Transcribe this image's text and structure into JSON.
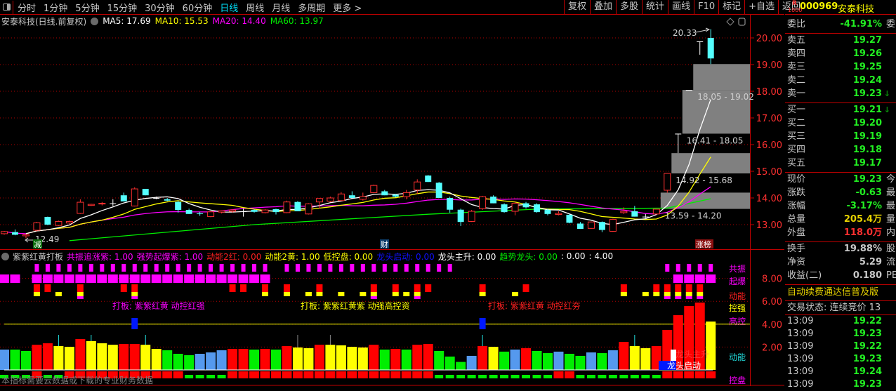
{
  "toolbar": {
    "periods": [
      "分时",
      "1分钟",
      "5分钟",
      "15分钟",
      "30分钟",
      "60分钟",
      "日线",
      "周线",
      "月线",
      "多周期",
      "更多 >"
    ],
    "active_period": "日线",
    "actions": [
      "复权",
      "叠加",
      "多股",
      "统计",
      "画线",
      "F10",
      "标记",
      "+自选",
      "返回"
    ]
  },
  "legend": {
    "title": "安泰科技(日线.前复权)",
    "ma5": "MA5: 17.69",
    "ma10": "MA10: 15.53",
    "ma20": "MA20: 14.40",
    "ma60": "MA60: 13.97"
  },
  "colors": {
    "up": "#ff3030",
    "down": "#54ffff",
    "ma5": "#ffffff",
    "ma10": "#ffff00",
    "ma20": "#ff00ff",
    "ma60": "#00ee00",
    "grid": "#b00000",
    "axis_text": "#ff3030",
    "gap_box": "#808080"
  },
  "main_chart": {
    "y_axis": [
      "20.00",
      "19.00",
      "18.00",
      "17.00",
      "16.00",
      "15.00",
      "14.00",
      "13.00"
    ],
    "candles": [
      [
        12.66,
        12.76,
        12.62,
        12.74
      ],
      [
        12.72,
        12.82,
        12.6,
        12.62
      ],
      [
        12.58,
        12.64,
        12.49,
        12.62
      ],
      [
        12.79,
        13.1,
        12.75,
        13.07
      ],
      [
        13.29,
        13.3,
        12.98,
        13.0
      ],
      [
        12.97,
        13.15,
        12.95,
        13.12
      ],
      [
        13.06,
        13.15,
        13.02,
        13.12
      ],
      [
        13.42,
        13.95,
        13.4,
        13.84
      ],
      [
        13.72,
        13.78,
        13.7,
        13.76
      ],
      [
        13.78,
        13.85,
        13.72,
        13.8
      ],
      [
        13.8,
        13.95,
        13.7,
        13.8
      ],
      [
        14.1,
        14.2,
        13.87,
        13.87
      ],
      [
        13.7,
        14.4,
        13.68,
        14.34
      ],
      [
        14.34,
        14.34,
        14.1,
        14.1
      ],
      [
        14.0,
        14.05,
        13.95,
        14.0
      ],
      [
        13.95,
        14.0,
        13.88,
        13.9
      ],
      [
        13.85,
        13.9,
        13.45,
        13.55
      ],
      [
        13.55,
        13.6,
        13.4,
        13.4
      ],
      [
        13.42,
        13.48,
        13.33,
        13.4
      ],
      [
        13.3,
        13.5,
        13.28,
        13.48
      ],
      [
        13.47,
        13.53,
        13.42,
        13.52
      ],
      [
        13.5,
        13.58,
        13.45,
        13.55
      ],
      [
        13.5,
        13.6,
        13.3,
        13.5
      ],
      [
        13.55,
        13.58,
        13.45,
        13.48
      ],
      [
        13.45,
        13.58,
        13.42,
        13.55
      ],
      [
        13.58,
        13.6,
        13.38,
        13.47
      ],
      [
        13.45,
        13.9,
        13.43,
        13.85
      ],
      [
        13.85,
        13.88,
        13.5,
        13.5
      ],
      [
        13.4,
        13.8,
        13.38,
        13.78
      ],
      [
        13.85,
        14.0,
        13.6,
        13.98
      ],
      [
        13.88,
        14.05,
        13.85,
        14.0
      ],
      [
        13.9,
        14.22,
        13.88,
        14.15
      ],
      [
        14.1,
        14.25,
        14.0,
        14.0
      ],
      [
        13.95,
        14.2,
        13.9,
        14.05
      ],
      [
        14.2,
        14.5,
        14.18,
        14.47
      ],
      [
        14.25,
        14.3,
        14.1,
        14.1
      ],
      [
        14.12,
        14.15,
        14.02,
        14.05
      ],
      [
        14.05,
        14.3,
        13.95,
        14.2
      ],
      [
        14.3,
        14.7,
        14.15,
        14.6
      ],
      [
        14.84,
        14.86,
        14.6,
        14.6
      ],
      [
        14.57,
        14.6,
        14.0,
        14.0
      ],
      [
        14.0,
        14.05,
        13.45,
        13.56
      ],
      [
        13.56,
        13.6,
        12.95,
        13.1
      ],
      [
        13.12,
        13.55,
        13.1,
        13.5
      ],
      [
        13.6,
        14.08,
        13.55,
        14.05
      ],
      [
        14.05,
        14.1,
        13.8,
        13.8
      ],
      [
        13.76,
        13.8,
        13.45,
        13.47
      ],
      [
        13.5,
        13.85,
        13.35,
        13.8
      ],
      [
        13.8,
        13.85,
        13.6,
        13.65
      ],
      [
        13.76,
        13.8,
        13.45,
        13.47
      ],
      [
        13.55,
        13.6,
        13.35,
        13.4
      ],
      [
        13.38,
        13.5,
        13.35,
        13.42
      ],
      [
        13.37,
        13.4,
        13.05,
        13.07
      ],
      [
        13.04,
        13.1,
        12.84,
        12.84
      ],
      [
        12.86,
        13.12,
        12.84,
        13.1
      ],
      [
        13.1,
        13.12,
        12.72,
        12.8
      ],
      [
        12.75,
        13.22,
        12.73,
        13.2
      ],
      [
        13.45,
        13.65,
        13.4,
        13.5
      ],
      [
        13.5,
        13.7,
        13.3,
        13.3
      ],
      [
        13.3,
        13.4,
        13.25,
        13.3
      ],
      [
        13.4,
        13.59,
        13.38,
        13.58
      ],
      [
        14.29,
        14.92,
        14.2,
        14.92
      ],
      [
        16.41,
        16.41,
        15.68,
        16.41
      ],
      [
        18.05,
        18.05,
        18.05,
        18.05
      ],
      [
        19.87,
        19.87,
        19.37,
        19.87
      ],
      [
        20.0,
        20.33,
        19.02,
        19.23
      ]
    ],
    "ma60_points": [
      [
        6,
        12.4
      ],
      [
        23,
        13.0
      ],
      [
        39,
        13.39
      ],
      [
        49,
        13.58
      ],
      [
        61,
        13.62
      ],
      [
        65,
        13.97
      ]
    ],
    "gaps": [
      {
        "label": "13.59 - 14.20",
        "low": 13.59,
        "high": 14.2,
        "after_index": 60
      },
      {
        "label": "14.92 - 15.68",
        "low": 14.92,
        "high": 15.68,
        "after_index": 61
      },
      {
        "label": "16.41 - 18.05",
        "low": 16.41,
        "high": 18.05,
        "after_index": 62
      },
      {
        "label": "18.05 - 19.02",
        "low": 18.05,
        "high": 19.02,
        "after_index": 63
      }
    ],
    "high_label": "20.33",
    "low_label": "12.49",
    "badges": {
      "reduce": "减",
      "finance": "财",
      "limit_up_list": "涨榜"
    }
  },
  "indicator": {
    "name": "紫紫红黄打板",
    "params": [
      {
        "text": "共振追涨紫: 1.00",
        "color": "#ff00ff"
      },
      {
        "text": "强势起爆紫: 1.00",
        "color": "#ff00ff"
      },
      {
        "text": "动能2红: 0.00",
        "color": "#ff2020"
      },
      {
        "text": "动能2黄: 1.00",
        "color": "#ffff00"
      },
      {
        "text": "低控盘: 0.00",
        "color": "#ffff00"
      },
      {
        "text": "龙头启动: 0.00",
        "color": "#1010ff"
      },
      {
        "text": "龙头主升: 0.00",
        "color": "#ffffff"
      },
      {
        "text": "趋势龙头: 0.00",
        "color": "#00ee00"
      },
      {
        "text": ": 0.00",
        "color": "#ffffff"
      },
      {
        "text": ": 4.00",
        "color": "#ffffff"
      }
    ],
    "y_axis": [
      "8.00",
      "6.00",
      "4.00",
      "2.00"
    ],
    "side_labels": [
      {
        "text": "共振",
        "color": "#ff00ff"
      },
      {
        "text": "起爆",
        "color": "#ff00ff"
      },
      {
        "text": "动能",
        "color": "#ff2020"
      },
      {
        "text": "控强",
        "color": "#ffff00"
      },
      {
        "text": "高控",
        "color": "#ff00ff"
      },
      {
        "text": "动能",
        "color": "#22dddd"
      },
      {
        "text": "控盘",
        "color": "#ff00ff"
      }
    ],
    "signals": [
      {
        "text": "打板: 紫紫红黄 动控红强",
        "color": "#ff00ff"
      },
      {
        "text": "打板: 紫紫红黄紫 动强高控资",
        "color": "#ffff00"
      },
      {
        "text": "打板: 紫紫红黄 动控红夯",
        "color": "#ff2020"
      }
    ],
    "resonance_idx": [
      3,
      4,
      5,
      6,
      7,
      8,
      9,
      10,
      11,
      12,
      13,
      14,
      15,
      16,
      17,
      18,
      19,
      20,
      21,
      22,
      23,
      24,
      26,
      27,
      28,
      29,
      30,
      31,
      32,
      33,
      34,
      35,
      36,
      37,
      38,
      39,
      40,
      41,
      61,
      62,
      63,
      64,
      65
    ],
    "breakout_idx": [
      0,
      1,
      3,
      4,
      5,
      6,
      7,
      8,
      9,
      10,
      11,
      12,
      13,
      14,
      15,
      16,
      17,
      18,
      19,
      20,
      21,
      22,
      23,
      24,
      62,
      63,
      64,
      65
    ],
    "momentum_red_idx": [
      3,
      4,
      7,
      11,
      12,
      21,
      22,
      24,
      26,
      29,
      34,
      36,
      38,
      39,
      44,
      48,
      57,
      60,
      61,
      62,
      63,
      64
    ],
    "momentum_yellow_idx": [
      3,
      5,
      7,
      12,
      24,
      26,
      28,
      29,
      31,
      33,
      34,
      36,
      37,
      38,
      44,
      47,
      57,
      59,
      60,
      61,
      62,
      63,
      64
    ],
    "momentum_purple_idx": [
      7,
      12,
      34,
      38,
      61,
      62,
      63,
      64
    ],
    "bar_values": [
      1.78,
      1.78,
      1.66,
      2.2,
      2.33,
      2.09,
      2.02,
      2.7,
      2.52,
      2.33,
      2.2,
      2.27,
      2.27,
      2.2,
      1.84,
      1.72,
      1.41,
      1.29,
      1.41,
      1.53,
      1.72,
      1.84,
      1.84,
      1.78,
      1.84,
      1.78,
      2.09,
      1.96,
      1.9,
      2.2,
      2.2,
      2.15,
      2.02,
      1.96,
      2.2,
      1.78,
      1.84,
      1.78,
      2.2,
      2.27,
      1.66,
      1.17,
      0.7,
      1.23,
      2.09,
      2.02,
      1.6,
      1.78,
      1.9,
      1.66,
      1.47,
      1.6,
      1.41,
      1.23,
      1.53,
      1.47,
      1.72,
      2.45,
      2.09,
      1.9,
      2.09,
      3.5,
      4.79,
      5.58,
      5.89,
      4.23
    ],
    "bar_colors": "bggrryyryyyrryygggbbbrrgrgryyryyyyrgrgrrgggbrygbrggbggbgbryyrrrrry",
    "lower_colors": "gggrggrrrrrrrrrrrggggrrrrrrrrrrrrrrrrrrrgggggggggggrrggggggggrrrrr",
    "high_control_level": 4.0,
    "dragon_start_idx": [
      12,
      44
    ],
    "cyan_marks_idx": [
      5,
      8,
      13,
      44,
      58,
      65
    ],
    "grey_marks_idx": [
      27,
      30
    ],
    "dragon_start_label": "龙头启动",
    "dragon_rise_label": "龙头主升",
    "footnote": "本指标需要云数据或下载的专业财务数据"
  },
  "quote_panel": {
    "badge_r": "R",
    "badge_level": "1000",
    "code": "000969",
    "name": "安泰科技",
    "order_ratio": {
      "label": "委比",
      "value": "-41.91%",
      "ext": "委"
    },
    "asks": [
      {
        "label": "卖五",
        "price": "19.27"
      },
      {
        "label": "卖四",
        "price": "19.26"
      },
      {
        "label": "卖三",
        "price": "19.25"
      },
      {
        "label": "卖二",
        "price": "19.24"
      },
      {
        "label": "卖一",
        "price": "19.23",
        "arrow": "↓"
      }
    ],
    "bids": [
      {
        "label": "买一",
        "price": "19.21",
        "arrow": "↓"
      },
      {
        "label": "买二",
        "price": "19.20"
      },
      {
        "label": "买三",
        "price": "19.19"
      },
      {
        "label": "买四",
        "price": "19.18"
      },
      {
        "label": "买五",
        "price": "19.17"
      }
    ],
    "stats": [
      {
        "label": "现价",
        "value": "19.23",
        "ext": "今",
        "cls": "green"
      },
      {
        "label": "涨跌",
        "value": "-0.63",
        "ext": "最",
        "cls": "green"
      },
      {
        "label": "涨幅",
        "value": "-3.17%",
        "ext": "最",
        "cls": "green"
      },
      {
        "label": "总量",
        "value": "205.4万",
        "ext": "量",
        "cls": "yellow"
      },
      {
        "label": "外盘",
        "value": "118.0万",
        "ext": "内",
        "cls": "red"
      }
    ],
    "fundamentals": [
      {
        "label": "换手",
        "value": "19.88%",
        "ext": "股"
      },
      {
        "label": "净资",
        "value": "5.29",
        "ext": "流"
      },
      {
        "label": "收益(二)",
        "value": "0.180",
        "ext": "PE"
      }
    ],
    "promo": "自动续费通达信普及版",
    "trade_status": "交易状态: 连续竞价 13",
    "ticks": [
      {
        "time": "13:09",
        "price": "19.22"
      },
      {
        "time": "13:09",
        "price": "19.23"
      },
      {
        "time": "13:09",
        "price": "19.22"
      },
      {
        "time": "13:09",
        "price": "19.23"
      },
      {
        "time": "13:09",
        "price": "19.24"
      },
      {
        "time": "13:09",
        "price": "19.23"
      }
    ]
  }
}
